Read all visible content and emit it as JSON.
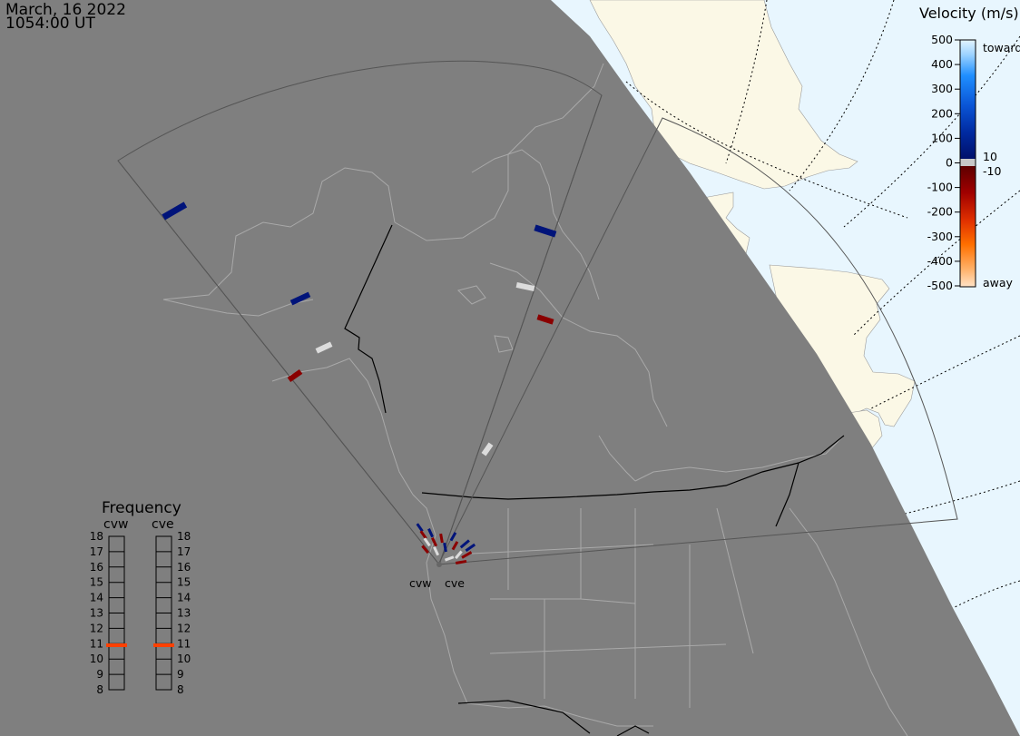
{
  "header": {
    "date": "March, 16 2022",
    "time": "1054:00 UT"
  },
  "velocity_legend": {
    "title": "Velocity (m/s)",
    "ticks": [
      "500",
      "400",
      "300",
      "200",
      "100",
      "0",
      "-100",
      "-200",
      "-300",
      "-400",
      "-500"
    ],
    "label_toward": "toward",
    "label_away": "away",
    "label_pos_threshold": "10",
    "label_neg_threshold": "-10",
    "colors": {
      "toward_light": "#d6eefe",
      "toward_mid": "#1f8fff",
      "toward_dark": "#00147a",
      "ground_scatter": "#c8c8c8",
      "away_dark": "#7a0000",
      "away_mid": "#ff7000",
      "away_light": "#ffd9b0"
    }
  },
  "frequency_legend": {
    "title": "Frequency",
    "radars": [
      "cvw",
      "cve"
    ],
    "ticks": [
      "18",
      "17",
      "16",
      "15",
      "14",
      "13",
      "12",
      "11",
      "10",
      "9",
      "8"
    ],
    "active_mhz": {
      "cvw": 10.9,
      "cve": 10.9
    },
    "indicator_color": "#ff4000"
  },
  "sites": {
    "west": "cvw",
    "east": "cve"
  },
  "colors": {
    "night": "#7f7f7f",
    "ocean": "#e8f6fe",
    "land": "#fbf8e6",
    "coastline_night": "#a9a9a9",
    "political": "#000000",
    "fov": "#555555"
  }
}
